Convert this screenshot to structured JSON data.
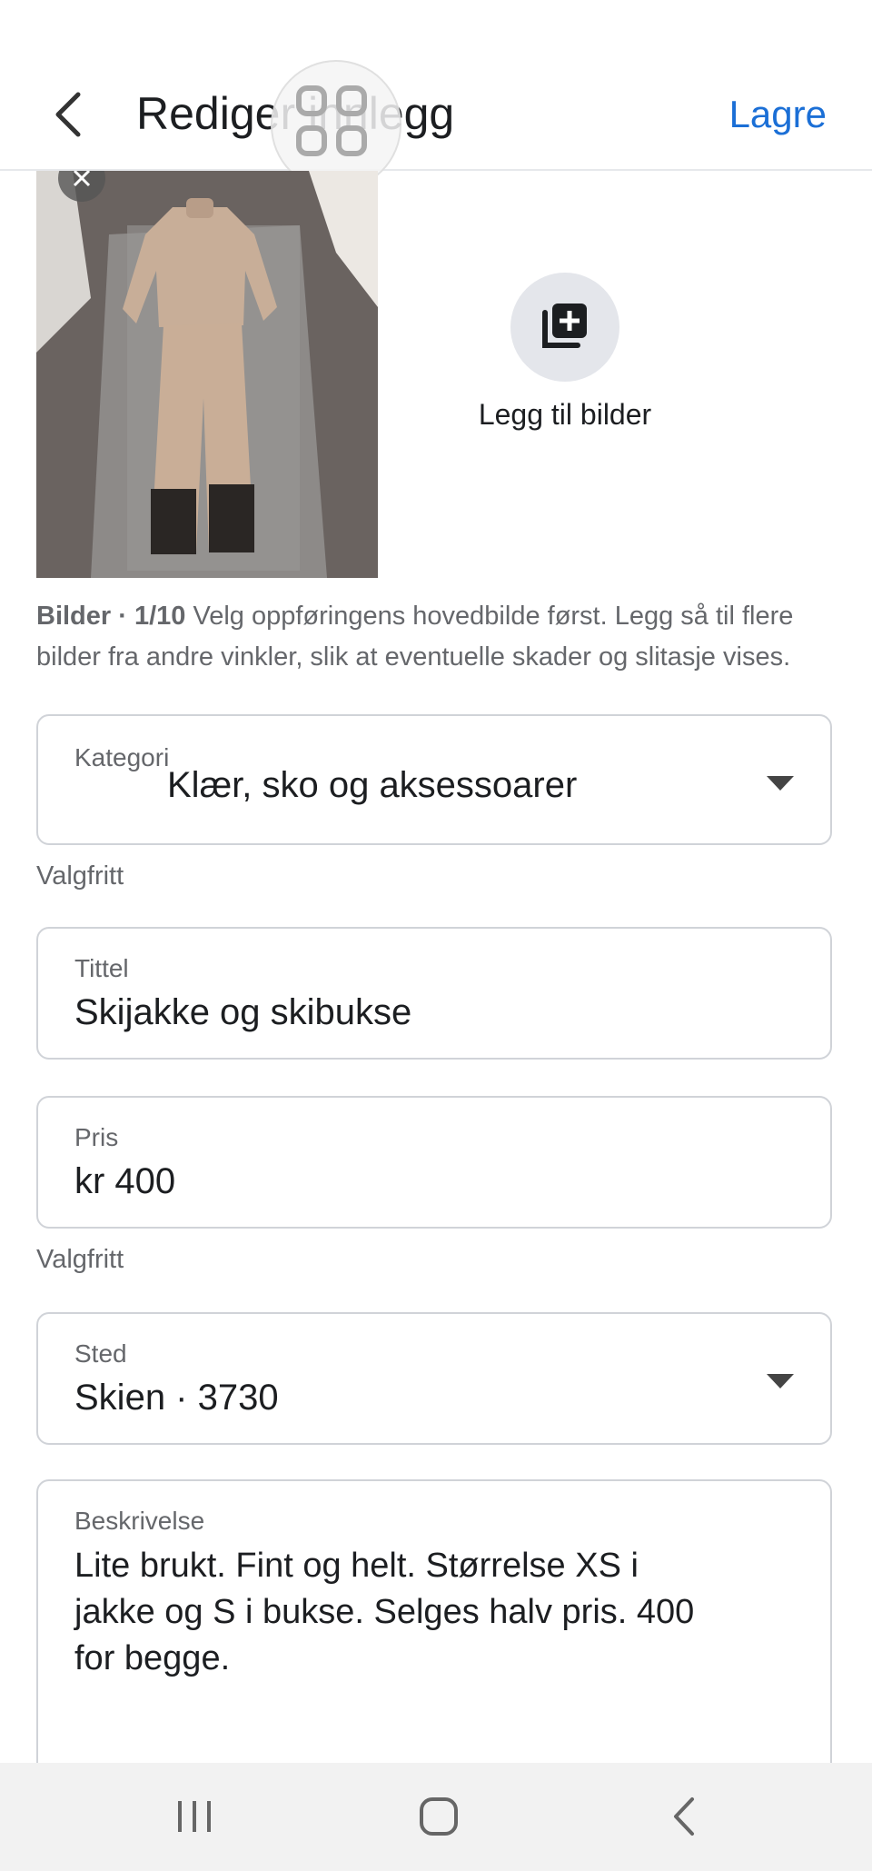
{
  "header": {
    "title": "Rediger innlegg",
    "save_label": "Lagre"
  },
  "photos": {
    "add_label": "Legg til bilder",
    "count_label": "Bilder · 1/10",
    "helper_text": " Velg oppføringens hovedbilde først. Legg så til flere bilder fra andre vinkler, slik at eventuelle skader og slitasje vises."
  },
  "fields": {
    "category": {
      "label": "Kategori",
      "value": "Klær, sko og aksessoarer",
      "note": "Valgfritt"
    },
    "title": {
      "label": "Tittel",
      "value": "Skijakke og skibukse"
    },
    "price": {
      "label": "Pris",
      "value": "kr 400",
      "note": "Valgfritt"
    },
    "location": {
      "label": "Sted",
      "value": "Skien · 3730"
    },
    "description": {
      "label": "Beskrivelse",
      "value": "Lite brukt. Fint og helt. Størrelse XS i jakke og S i bukse. Selges halv pris. 400 for begge."
    }
  },
  "icons": {
    "back": "chevron-left-icon",
    "overlay": "grid-icon",
    "add_photo": "add-photo-icon",
    "remove_photo": "close-icon",
    "nav_recents": "recents-icon",
    "nav_home": "home-icon",
    "nav_back": "back-icon"
  },
  "colors": {
    "accent": "#1b6fd6",
    "text": "#1c1e21",
    "muted": "#65676b",
    "border": "#d0d3d8"
  }
}
